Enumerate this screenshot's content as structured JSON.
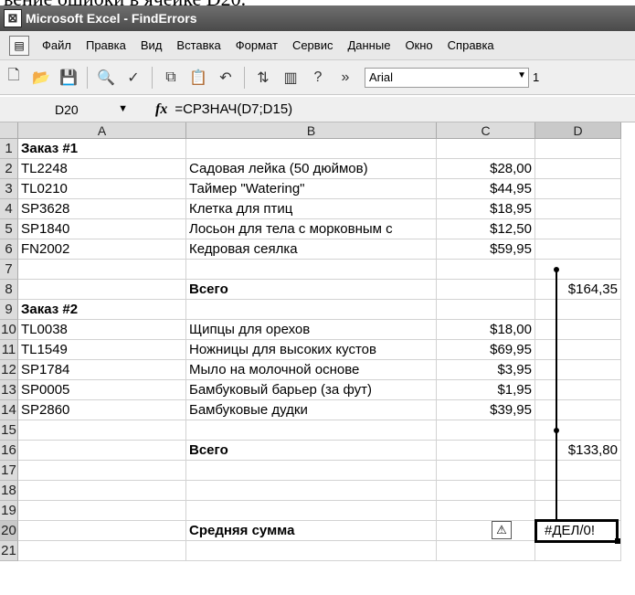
{
  "caption": "вение ошибки в ячейке D20.",
  "window": {
    "title": "Microsoft Excel - FindErrors"
  },
  "menu": [
    "Файл",
    "Правка",
    "Вид",
    "Вставка",
    "Формат",
    "Сервис",
    "Данные",
    "Окно",
    "Справка"
  ],
  "toolbar": {
    "font": "Arial",
    "font_size": "1"
  },
  "formula_bar": {
    "cell_ref": "D20",
    "fx": "fx",
    "formula": "=СРЗНАЧ(D7;D15)"
  },
  "columns": [
    "A",
    "B",
    "C",
    "D"
  ],
  "rows": [
    {
      "n": "1",
      "a": "Заказ #1",
      "b": "",
      "c": "",
      "d": "",
      "bold_a": true
    },
    {
      "n": "2",
      "a": "TL2248",
      "b": "Садовая лейка (50 дюймов)",
      "c": "$28,00",
      "d": ""
    },
    {
      "n": "3",
      "a": "TL0210",
      "b": "Таймер \"Watering\"",
      "c": "$44,95",
      "d": ""
    },
    {
      "n": "4",
      "a": "SP3628",
      "b": "Клетка для птиц",
      "c": "$18,95",
      "d": ""
    },
    {
      "n": "5",
      "a": "SP1840",
      "b": "Лосьон для тела с морковным с",
      "c": "$12,50",
      "d": ""
    },
    {
      "n": "6",
      "a": "FN2002",
      "b": "Кедровая сеялка",
      "c": "$59,95",
      "d": ""
    },
    {
      "n": "7",
      "a": "",
      "b": "",
      "c": "",
      "d": ""
    },
    {
      "n": "8",
      "a": "",
      "b": "Всего",
      "c": "",
      "d": "$164,35",
      "bold_b": true
    },
    {
      "n": "9",
      "a": "Заказ #2",
      "b": "",
      "c": "",
      "d": "",
      "bold_a": true
    },
    {
      "n": "10",
      "a": "TL0038",
      "b": "Щипцы для орехов",
      "c": "$18,00",
      "d": ""
    },
    {
      "n": "11",
      "a": "TL1549",
      "b": "Ножницы для высоких кустов",
      "c": "$69,95",
      "d": ""
    },
    {
      "n": "12",
      "a": "SP1784",
      "b": "Мыло на молочной основе",
      "c": "$3,95",
      "d": ""
    },
    {
      "n": "13",
      "a": "SP0005",
      "b": "Бамбуковый барьер (за фут)",
      "c": "$1,95",
      "d": ""
    },
    {
      "n": "14",
      "a": "SP2860",
      "b": "Бамбуковые дудки",
      "c": "$39,95",
      "d": ""
    },
    {
      "n": "15",
      "a": "",
      "b": "",
      "c": "",
      "d": ""
    },
    {
      "n": "16",
      "a": "",
      "b": "Всего",
      "c": "",
      "d": "$133,80",
      "bold_b": true
    },
    {
      "n": "17",
      "a": "",
      "b": "",
      "c": "",
      "d": ""
    },
    {
      "n": "18",
      "a": "",
      "b": "",
      "c": "",
      "d": ""
    },
    {
      "n": "19",
      "a": "",
      "b": "",
      "c": "",
      "d": ""
    },
    {
      "n": "20",
      "a": "",
      "b": "Средняя сумма",
      "c": "",
      "d": "",
      "bold_b": true
    },
    {
      "n": "21",
      "a": "",
      "b": "",
      "c": "",
      "d": ""
    }
  ],
  "selected": {
    "ref": "D20",
    "value": "#ДЕЛ/0!"
  },
  "error_icon": "warning-diamond-icon"
}
